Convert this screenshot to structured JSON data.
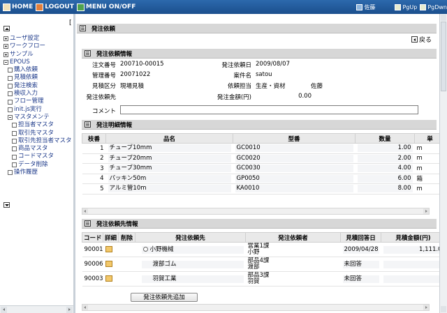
{
  "topbar": {
    "home": "HOME",
    "logout": "LOGOUT",
    "menu": "MENU ON/OFF",
    "user": "佐藤",
    "pgup": "PgUp",
    "pgdn": "PgDwn"
  },
  "sidebar": {
    "bracket": "[",
    "items": [
      {
        "label": "ユーザ設定",
        "marker": "plus",
        "level": 1
      },
      {
        "label": "ワークフロー",
        "marker": "plus",
        "level": 1
      },
      {
        "label": "サンプル",
        "marker": "plus",
        "level": 1
      },
      {
        "label": "EPOUS",
        "marker": "minus",
        "level": 1
      },
      {
        "label": "購入依頼",
        "marker": "box",
        "level": 2
      },
      {
        "label": "見積依頼",
        "marker": "box",
        "level": 2
      },
      {
        "label": "発注検索",
        "marker": "box",
        "level": 2
      },
      {
        "label": "検収入力",
        "marker": "box",
        "level": 2
      },
      {
        "label": "フロー管理",
        "marker": "box",
        "level": 2
      },
      {
        "label": "init.js実行",
        "marker": "box",
        "level": 2
      },
      {
        "label": "マスタメンテ",
        "marker": "minus",
        "level": 2
      },
      {
        "label": "担当者マスタ",
        "marker": "box",
        "level": 3
      },
      {
        "label": "取引先マスタ",
        "marker": "box",
        "level": 3
      },
      {
        "label": "取引先担当者マスタ",
        "marker": "box",
        "level": 3
      },
      {
        "label": "商品マスタ",
        "marker": "box",
        "level": 3
      },
      {
        "label": "コードマスタ",
        "marker": "box",
        "level": 3
      },
      {
        "label": "データ削除",
        "marker": "box",
        "level": 3
      },
      {
        "label": "操作履歴",
        "marker": "box",
        "level": 2
      }
    ]
  },
  "page": {
    "title": "発注依頼",
    "back": "戻る"
  },
  "info": {
    "title": "発注依頼情報",
    "order_no_label": "注文番号",
    "order_no": "200710-00015",
    "order_date_label": "発注依頼日",
    "order_date": "2009/08/07",
    "mgmt_no_label": "管理番号",
    "mgmt_no": "20071022",
    "case_label": "案件名",
    "case": "satou",
    "quote_type_label": "見積区分",
    "quote_type": "現場見積",
    "requester_label": "依頼担当",
    "requester_dept": "生産・資材",
    "requester_name": "佐藤",
    "vendor_label": "発注依頼先",
    "vendor": "",
    "amount_label": "発注金額(円)",
    "amount": "0.00",
    "comment_label": "コメント",
    "comment": ""
  },
  "detail": {
    "title": "発注明細情報",
    "headers": [
      "枝番",
      "品名",
      "型番",
      "数量",
      "単"
    ],
    "rows": [
      {
        "no": "1",
        "name": "チューブ10mm",
        "model": "GC0010",
        "qty": "1.00",
        "unit": "m"
      },
      {
        "no": "2",
        "name": "チューブ20mm",
        "model": "GC0020",
        "qty": "2.00",
        "unit": "m"
      },
      {
        "no": "3",
        "name": "チューブ30mm",
        "model": "GC0030",
        "qty": "4.00",
        "unit": "m"
      },
      {
        "no": "4",
        "name": "パッキン50m",
        "model": "GP0050",
        "qty": "6.00",
        "unit": "箱"
      },
      {
        "no": "5",
        "name": "アルミ管10m",
        "model": "KA0010",
        "qty": "8.00",
        "unit": "m"
      }
    ]
  },
  "vendors": {
    "title": "発注依頼先情報",
    "headers": [
      "コード",
      "詳細",
      "削除",
      "発注依頼先",
      "発注依頼者",
      "見積回答日",
      "見積金額(円)"
    ],
    "rows": [
      {
        "code": "90001",
        "name": "小野機械",
        "dept": "営業1課",
        "person": "小野",
        "date": "2009/04/28",
        "amount": "1,111.0"
      },
      {
        "code": "90006",
        "name": "渡部ゴム",
        "dept": "部品4課",
        "person": "渡部",
        "date": "未回答",
        "amount": ""
      },
      {
        "code": "90003",
        "name": "羽賀工業",
        "dept": "部品3課",
        "person": "羽賀",
        "date": "未回答",
        "amount": ""
      }
    ],
    "add_button": "発注依頼先追加"
  }
}
